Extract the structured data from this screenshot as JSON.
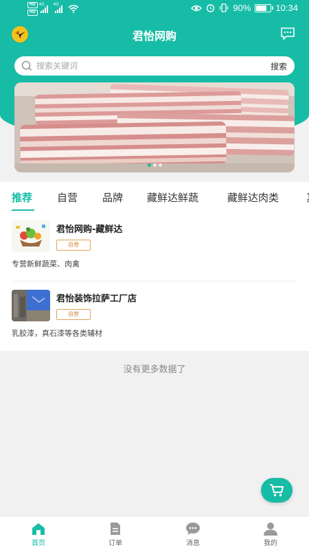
{
  "status_bar": {
    "hd_badges": [
      "HD",
      "HD"
    ],
    "network_tags": [
      "4G",
      "4G"
    ],
    "battery_percent": "90%",
    "battery_level": 0.9,
    "time": "10:34"
  },
  "header": {
    "title": "君怡网购"
  },
  "search": {
    "placeholder": "搜索关键词",
    "button_label": "搜索"
  },
  "banner": {
    "image_desc": "pork belly",
    "slide_count": 3,
    "active_slide": 1
  },
  "tabs": [
    {
      "label": "推荐",
      "active": true
    },
    {
      "label": "自营",
      "active": false
    },
    {
      "label": "品牌",
      "active": false
    },
    {
      "label": "藏鲜达鲜蔬",
      "active": false
    },
    {
      "label": "藏鲜达肉类",
      "active": false
    },
    {
      "label": "其",
      "active": false
    }
  ],
  "stores": [
    {
      "name": "君怡网购-藏鲜达",
      "tag": "自营",
      "description": "专营新鲜蔬菜、肉禽"
    },
    {
      "name": "君怡装饰拉萨工厂店",
      "tag": "自营",
      "description": "乳胶漆，真石漆等各类辅材"
    }
  ],
  "list_footer": "没有更多数据了",
  "bottom_nav": [
    {
      "label": "首页",
      "icon": "home-icon",
      "active": true
    },
    {
      "label": "订单",
      "icon": "order-icon",
      "active": false
    },
    {
      "label": "消息",
      "icon": "message-icon",
      "active": false
    },
    {
      "label": "我的",
      "icon": "user-icon",
      "active": false
    }
  ],
  "colors": {
    "accent": "#17bca6",
    "tag_border": "#e0a15a",
    "page_bg": "#f1f1f1"
  }
}
